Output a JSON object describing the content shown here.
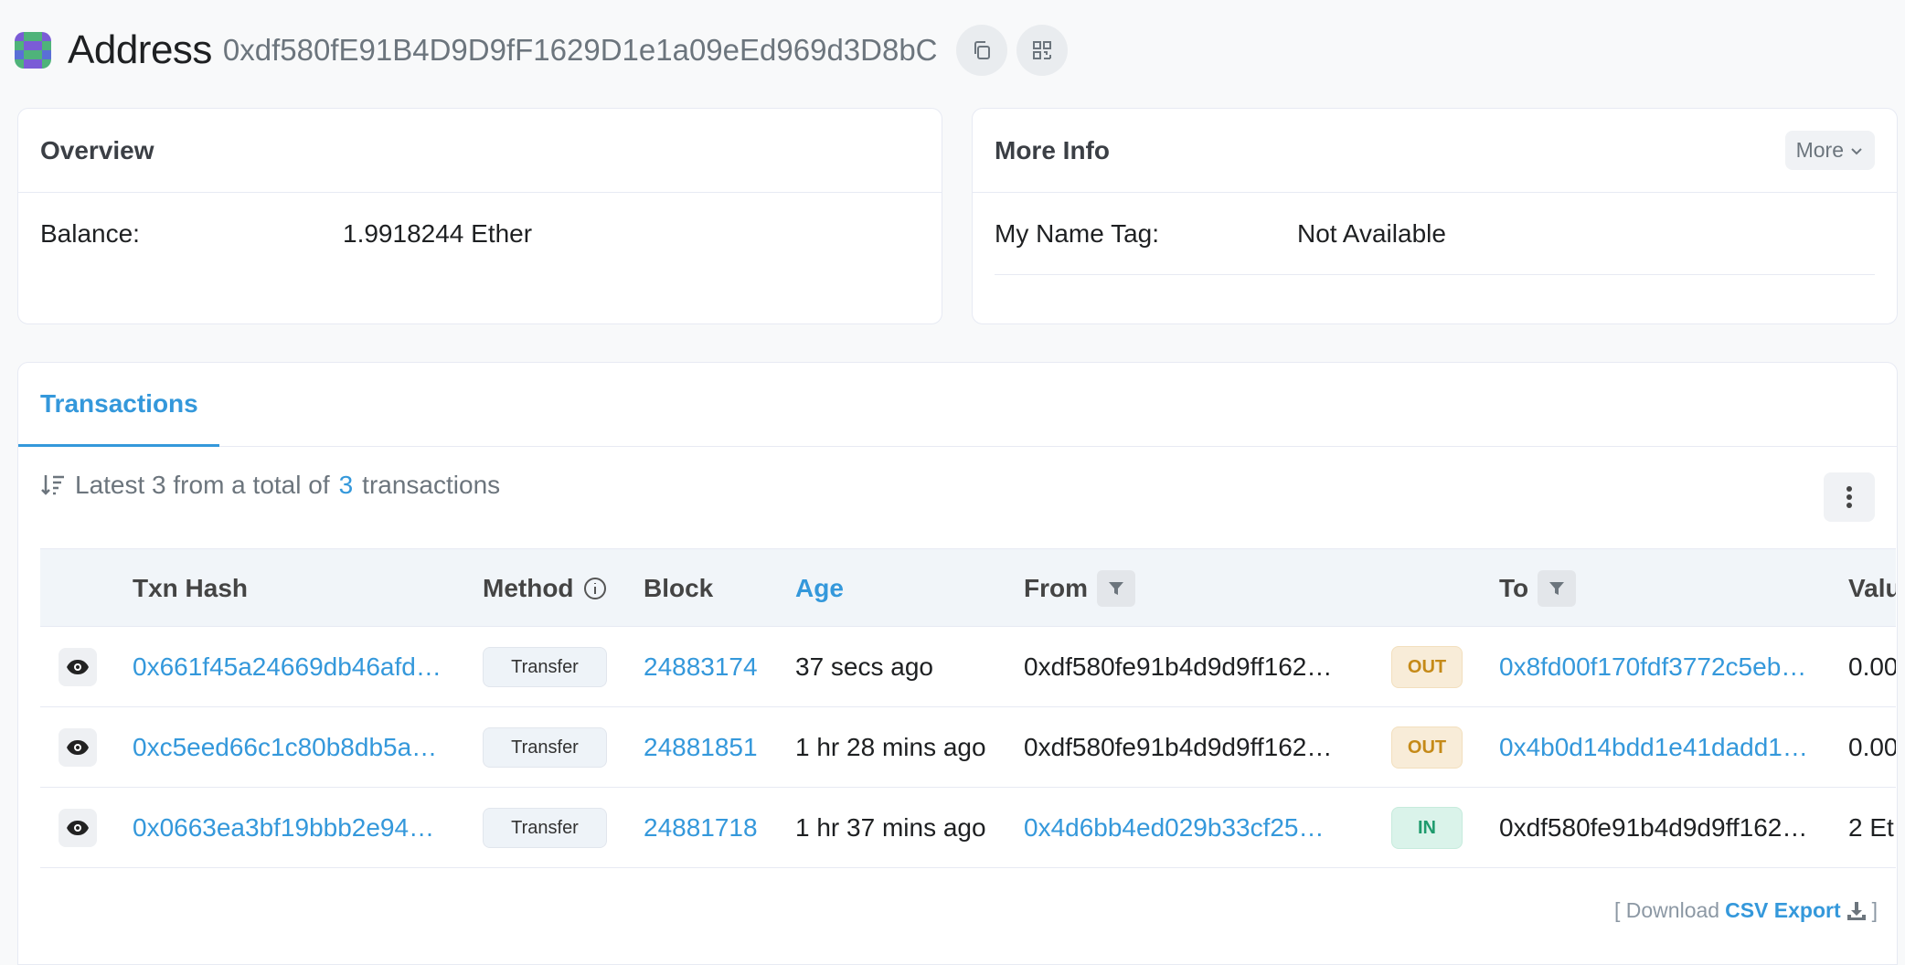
{
  "header": {
    "title": "Address",
    "address": "0xdf580fE91B4D9D9fF1629D1e1a09eEd969d3D8bC"
  },
  "overview": {
    "title": "Overview",
    "balance_label": "Balance:",
    "balance_value": "1.9918244 Ether"
  },
  "more_info": {
    "title": "More Info",
    "more_label": "More",
    "name_tag_label": "My Name Tag:",
    "name_tag_value": "Not Available"
  },
  "transactions": {
    "tab_label": "Transactions",
    "summary_prefix": "Latest 3 from a total of",
    "summary_count": "3",
    "summary_suffix": "transactions",
    "columns": {
      "hash": "Txn Hash",
      "method": "Method",
      "block": "Block",
      "age": "Age",
      "from": "From",
      "to": "To",
      "value": "Valu"
    },
    "rows": [
      {
        "hash": "0x661f45a24669db46afd…",
        "method": "Transfer",
        "block": "24883174",
        "age": "37 secs ago",
        "from": "0xdf580fe91b4d9d9ff162…",
        "direction": "OUT",
        "to": "0x8fd00f170fdf3772c5eb…",
        "value": "0.00"
      },
      {
        "hash": "0xc5eed66c1c80b8db5a…",
        "method": "Transfer",
        "block": "24881851",
        "age": "1 hr 28 mins ago",
        "from": "0xdf580fe91b4d9d9ff162…",
        "direction": "OUT",
        "to": "0x4b0d14bdd1e41dadd1…",
        "value": "0.00"
      },
      {
        "hash": "0x0663ea3bf19bbb2e94…",
        "method": "Transfer",
        "block": "24881718",
        "age": "1 hr 37 mins ago",
        "from": "0x4d6bb4ed029b33cf25…",
        "direction": "IN",
        "to": "0xdf580fe91b4d9d9ff162…",
        "value": "2 Et"
      }
    ],
    "footer": {
      "prefix": "[ Download",
      "link": "CSV Export",
      "suffix": "]"
    }
  },
  "colors": {
    "link": "#3498db",
    "out_badge": "#c58a18",
    "in_badge": "#1e9b6d"
  }
}
